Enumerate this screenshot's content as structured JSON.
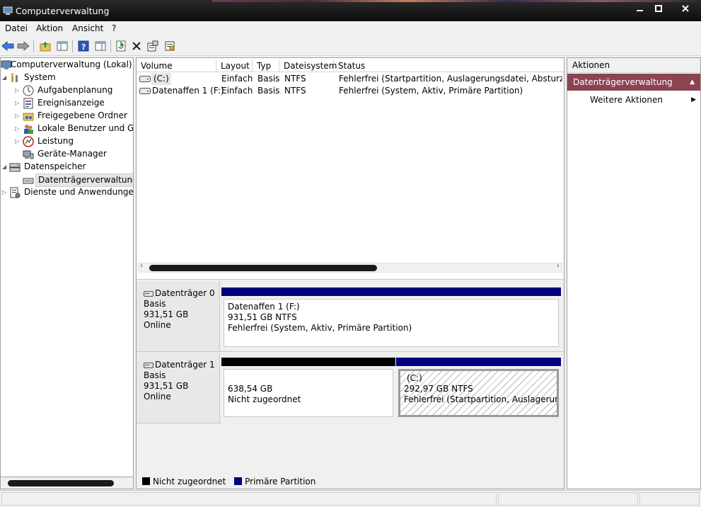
{
  "window": {
    "title": "Computerverwaltung"
  },
  "menu": [
    "Datei",
    "Aktion",
    "Ansicht",
    "?"
  ],
  "toolbar": {
    "icons": [
      "back-arrow-icon",
      "forward-arrow-icon",
      "up-folder-icon",
      "show-hide-tree-icon",
      "help-icon",
      "show-action-pane-icon",
      "refresh-icon",
      "delete-icon",
      "properties-icon",
      "export-icon"
    ]
  },
  "tree": {
    "root": "Computerverwaltung (Lokal)",
    "system": "System",
    "aufgabenplanung": "Aufgabenplanung",
    "ereignisanzeige": "Ereignisanzeige",
    "freigegebene": "Freigegebene Ordner",
    "benutzer": "Lokale Benutzer und Grup",
    "leistung": "Leistung",
    "geraete": "Geräte-Manager",
    "datenspeicher": "Datenspeicher",
    "datentraeger": "Datenträgerverwaltung",
    "dienste": "Dienste und Anwendungen"
  },
  "volumes": {
    "columns": [
      "Volume",
      "Layout",
      "Typ",
      "Dateisystem",
      "Status"
    ],
    "rows": [
      {
        "volume": "(C:)",
        "layout": "Einfach",
        "typ": "Basis",
        "fs": "NTFS",
        "status": "Fehlerfrei (Startpartition, Auslagerungsdatei, Absturzabbild, "
      },
      {
        "volume": "Datenaffen 1 (F:)",
        "layout": "Einfach",
        "typ": "Basis",
        "fs": "NTFS",
        "status": "Fehlerfrei (System, Aktiv, Primäre Partition)"
      }
    ]
  },
  "disks": [
    {
      "name": "Datenträger 0",
      "type": "Basis",
      "size": "931,51 GB",
      "state": "Online",
      "partitions": [
        {
          "line1": "Datenaffen 1  (F:)",
          "line2": "931,51 GB NTFS",
          "line3": "Fehlerfrei (System, Aktiv, Primäre Partition)"
        }
      ]
    },
    {
      "name": "Datenträger 1",
      "type": "Basis",
      "size": "931,51 GB",
      "state": "Online",
      "partitions": [
        {
          "line1": "638,54 GB",
          "line2": "Nicht zugeordnet"
        },
        {
          "line1": "(C:)",
          "line2": "292,97 GB NTFS",
          "line3": "Fehlerfrei (Startpartition, Auslagerungsda"
        }
      ]
    }
  ],
  "legend": {
    "unallocated": "Nicht zugeordnet",
    "primary": "Primäre Partition",
    "colors": {
      "unallocated": "#000000",
      "primary": "#000080"
    }
  },
  "actions": {
    "header": "Aktionen",
    "section": "Datenträgerverwaltung",
    "more": "Weitere Aktionen"
  }
}
